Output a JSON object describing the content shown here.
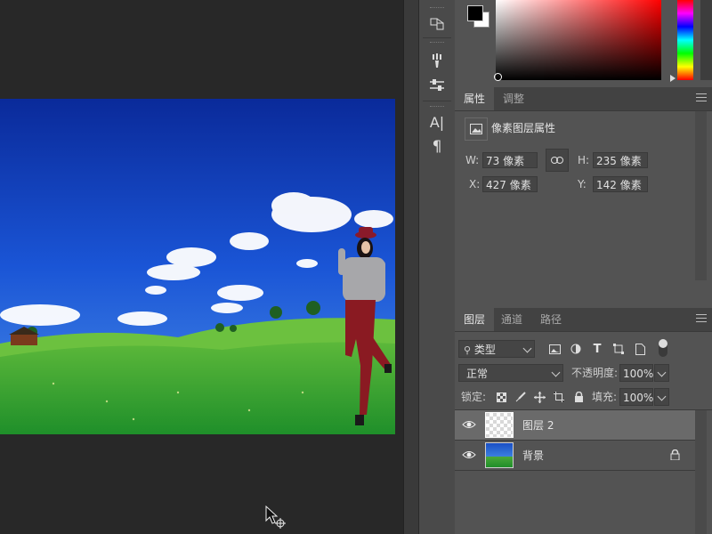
{
  "colors": {
    "workspace_bg": "#282828",
    "panel_bg": "#535353",
    "selected_layer_bg": "#6a6a6a",
    "foreground_color": "#000000",
    "background_color": "#ffffff"
  },
  "tools": [
    "move-to-3d-icon",
    "brush-settings-icon",
    "adjustments-icon",
    "character-icon",
    "paragraph-icon"
  ],
  "tool_glyphs": {
    "character": "A|",
    "paragraph": "¶"
  },
  "properties": {
    "tabs": [
      "属性",
      "调整"
    ],
    "header": "像素图层属性",
    "w_label": "W:",
    "w_value": "73 像素",
    "h_label": "H:",
    "h_value": "235 像素",
    "x_label": "X:",
    "x_value": "427 像素",
    "y_label": "Y:",
    "y_value": "142 像素"
  },
  "layers": {
    "tabs": [
      "图层",
      "通道",
      "路径"
    ],
    "filter_kind": "类型",
    "blend_mode": "正常",
    "opacity_label": "不透明度:",
    "opacity_value": "100%",
    "lock_label": "锁定:",
    "fill_label": "填充:",
    "fill_value": "100%",
    "items": [
      {
        "name": "图层 2",
        "selected": true,
        "visible": true,
        "locked": false
      },
      {
        "name": "背景",
        "selected": false,
        "visible": true,
        "locked": true
      }
    ]
  }
}
